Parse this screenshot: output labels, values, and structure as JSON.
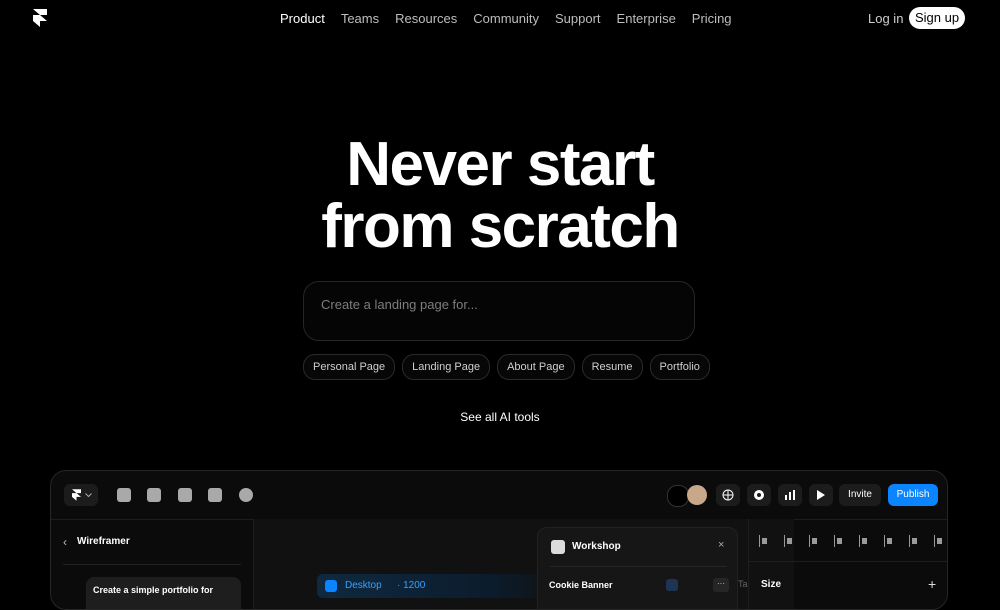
{
  "nav": {
    "links": [
      "Product",
      "Teams",
      "Resources",
      "Community",
      "Support",
      "Enterprise",
      "Pricing"
    ],
    "active": "Product",
    "login": "Log in",
    "signup": "Sign up"
  },
  "hero": {
    "title_line1": "Never start",
    "title_line2": "from scratch",
    "placeholder": "Create a landing page for...",
    "chips": [
      "Personal Page",
      "Landing Page",
      "About Page",
      "Resume",
      "Portfolio"
    ],
    "see_all": "See all AI tools"
  },
  "app": {
    "toolbar": {
      "invite": "Invite",
      "publish": "Publish",
      "accent": "#0a84ff"
    },
    "left_panel": {
      "title": "Wireframer",
      "back_icon": "chevron-left-icon",
      "prompt_card": "Create a simple portfolio for"
    },
    "canvas": {
      "breakpoint": "Desktop",
      "width": "1200"
    },
    "workshop": {
      "title": "Workshop",
      "close": "×",
      "item": "Cookie Banner",
      "more": "···",
      "overflow_text": "Ta"
    },
    "right_panel": {
      "size_label": "Size",
      "add": "+"
    }
  }
}
